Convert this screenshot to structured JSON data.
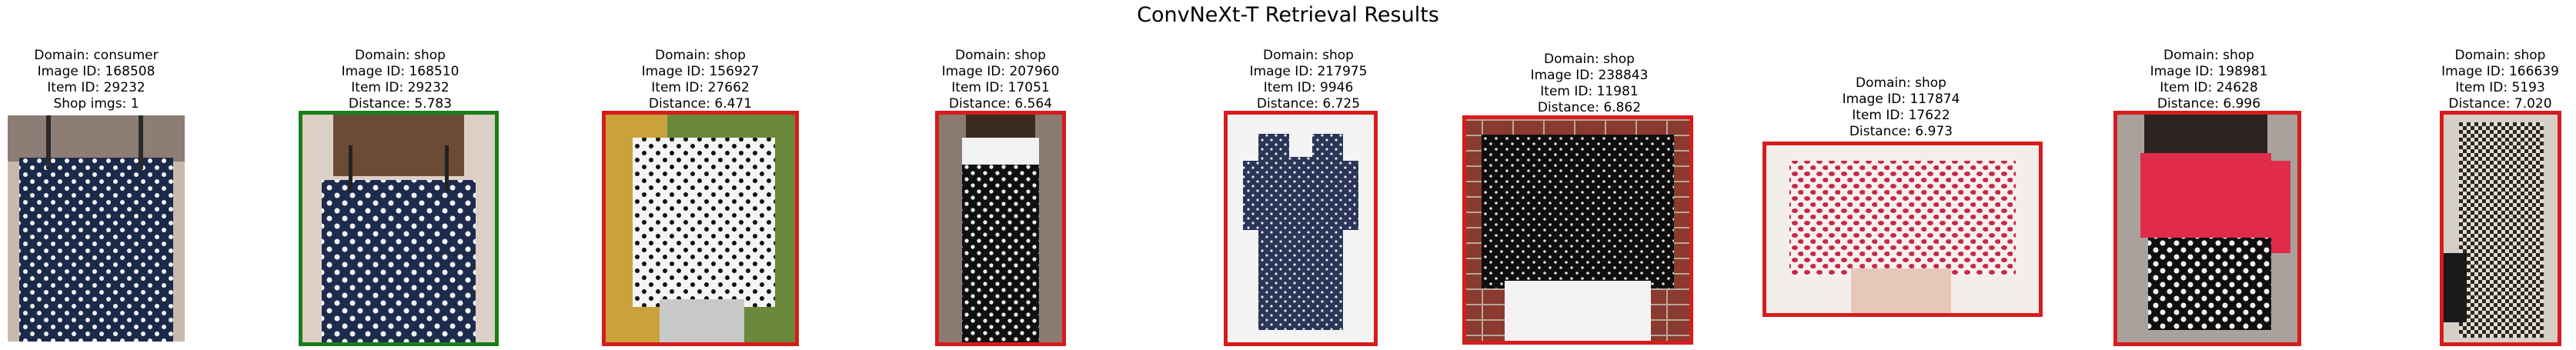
{
  "title": "ConvNeXt-T Retrieval Results",
  "colors": {
    "match_border": "#1a7f1a",
    "miss_border": "#d81c1c"
  },
  "panels": [
    {
      "domain": "Domain: consumer",
      "image_id": "Image ID: 168508",
      "item_id": "Item ID: 29232",
      "extra": "Shop imgs: 1",
      "kind": "query",
      "garment": "navy camisole with white polka dots"
    },
    {
      "domain": "Domain: shop",
      "image_id": "Image ID: 168510",
      "item_id": "Item ID: 29232",
      "extra": "Distance: 5.783",
      "kind": "match",
      "garment": "navy camisole with white polka dots"
    },
    {
      "domain": "Domain: shop",
      "image_id": "Image ID: 156927",
      "item_id": "Item ID: 27662",
      "extra": "Distance: 6.471",
      "kind": "miss",
      "garment": "white top with black polka dots"
    },
    {
      "domain": "Domain: shop",
      "image_id": "Image ID: 207960",
      "item_id": "Item ID: 17051",
      "extra": "Distance: 6.564",
      "kind": "miss",
      "garment": "black polka dot slip dress"
    },
    {
      "domain": "Domain: shop",
      "image_id": "Image ID: 217975",
      "item_id": "Item ID: 9946",
      "extra": "Distance: 6.725",
      "kind": "miss",
      "garment": "navy polka dot shirt dress"
    },
    {
      "domain": "Domain: shop",
      "image_id": "Image ID: 238843",
      "item_id": "Item ID: 11981",
      "extra": "Distance: 6.862",
      "kind": "miss",
      "garment": "black top with white dots"
    },
    {
      "domain": "Domain: shop",
      "image_id": "Image ID: 117874",
      "item_id": "Item ID: 17622",
      "extra": "Distance: 6.973",
      "kind": "miss",
      "garment": "white top with red pattern"
    },
    {
      "domain": "Domain: shop",
      "image_id": "Image ID: 198981",
      "item_id": "Item ID: 24628",
      "extra": "Distance: 6.996",
      "kind": "miss",
      "garment": "red top with polka dot skirt"
    },
    {
      "domain": "Domain: shop",
      "image_id": "Image ID: 166639",
      "item_id": "Item ID: 5193",
      "extra": "Distance: 7.020",
      "kind": "miss",
      "garment": "black and white check shirt"
    }
  ]
}
